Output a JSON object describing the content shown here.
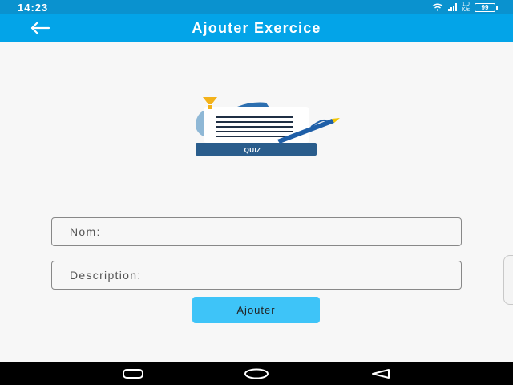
{
  "status_bar": {
    "time": "14:23",
    "network_speed_top": "1.0",
    "network_speed_bottom": "K/s",
    "battery": "99"
  },
  "app_bar": {
    "title": "Ajouter Exercice",
    "back_icon": "arrow-left-icon"
  },
  "illustration": {
    "label": "QUIZ"
  },
  "form": {
    "name_placeholder": "Nom:",
    "description_placeholder": "Description:",
    "submit_label": "Ajouter"
  },
  "colors": {
    "status_bar": "#0a92cf",
    "app_bar": "#03a4e8",
    "button": "#3ec4f8",
    "background": "#f7f7f7"
  },
  "nav_bar": {
    "icons": [
      "recent-apps-icon",
      "home-icon",
      "back-icon"
    ]
  }
}
